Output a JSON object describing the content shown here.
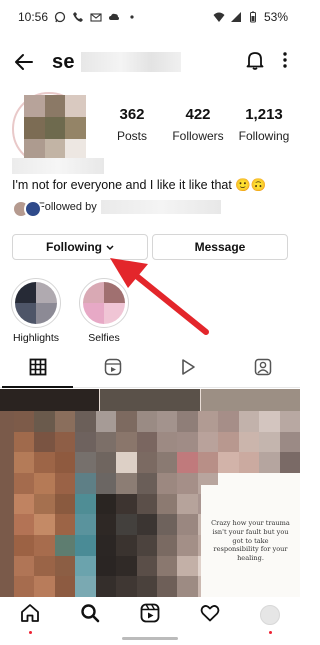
{
  "status_bar": {
    "time": "10:56",
    "battery": "53%"
  },
  "header": {
    "username": "se",
    "back_icon": "back-arrow-icon",
    "notification_icon": "bell-icon",
    "menu_icon": "vertical-dots-icon"
  },
  "profile": {
    "stats": [
      {
        "value": "362",
        "label": "Posts"
      },
      {
        "value": "422",
        "label": "Followers"
      },
      {
        "value": "1,213",
        "label": "Following"
      }
    ],
    "bio": "I'm not for everyone and I like it like that 🙂🙃",
    "followed_by": "Followed by"
  },
  "buttons": {
    "following": "Following",
    "message": "Message"
  },
  "highlights": [
    {
      "label": "Highlights"
    },
    {
      "label": "Selfies"
    }
  ],
  "tabs": [
    {
      "icon": "grid-icon",
      "active": true
    },
    {
      "icon": "reels-icon"
    },
    {
      "icon": "play-icon"
    },
    {
      "icon": "tagged-icon"
    }
  ],
  "quote": "Crazy how your trauma isn't your fault but you got to take responsibility for your healing.",
  "bottom_nav": [
    {
      "icon": "home-icon"
    },
    {
      "icon": "search-icon"
    },
    {
      "icon": "reels-icon"
    },
    {
      "icon": "heart-icon"
    },
    {
      "icon": "profile-icon"
    }
  ],
  "colors": {
    "annotation_arrow": "#e3262b",
    "notification_dot": "#e23344"
  }
}
